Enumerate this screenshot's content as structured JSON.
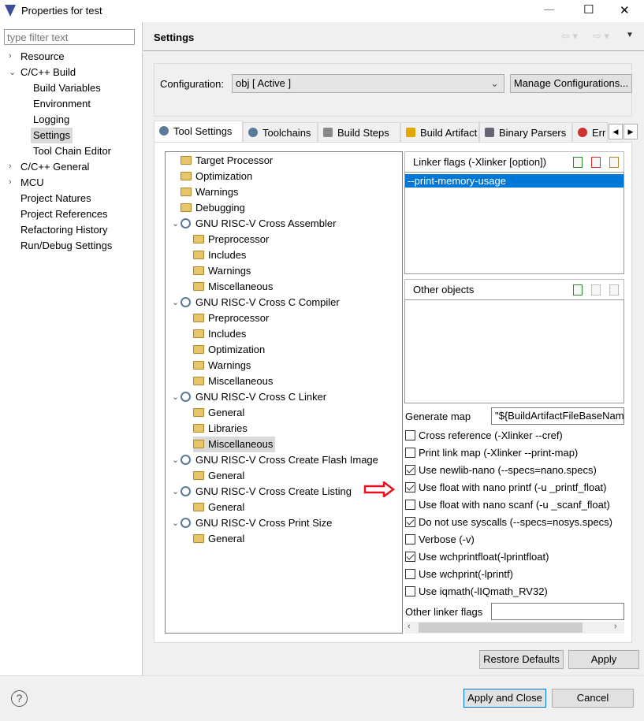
{
  "window": {
    "title": "Properties for test",
    "minimize": "—",
    "maximize": "☐",
    "close": "✕"
  },
  "filter": {
    "placeholder": "type filter text"
  },
  "nav": [
    {
      "label": "Resource",
      "level": 0,
      "chevron": "›"
    },
    {
      "label": "C/C++ Build",
      "level": 0,
      "chevron": "⌄"
    },
    {
      "label": "Build Variables",
      "level": 1
    },
    {
      "label": "Environment",
      "level": 1
    },
    {
      "label": "Logging",
      "level": 1
    },
    {
      "label": "Settings",
      "level": 1,
      "selected": true
    },
    {
      "label": "Tool Chain Editor",
      "level": 1
    },
    {
      "label": "C/C++ General",
      "level": 0,
      "chevron": "›"
    },
    {
      "label": "MCU",
      "level": 0,
      "chevron": "›"
    },
    {
      "label": "Project Natures",
      "level": 0
    },
    {
      "label": "Project References",
      "level": 0
    },
    {
      "label": "Refactoring History",
      "level": 0
    },
    {
      "label": "Run/Debug Settings",
      "level": 0
    }
  ],
  "header": {
    "title": "Settings"
  },
  "config": {
    "label": "Configuration:",
    "value": "obj  [ Active ]",
    "manage": "Manage Configurations..."
  },
  "tabs": [
    {
      "label": "Tool Settings",
      "active": true
    },
    {
      "label": "Toolchains"
    },
    {
      "label": "Build Steps"
    },
    {
      "label": "Build Artifact"
    },
    {
      "label": "Binary Parsers"
    },
    {
      "label": "Err"
    }
  ],
  "tooltree": [
    {
      "label": "Target Processor",
      "level": 0,
      "type": "folder"
    },
    {
      "label": "Optimization",
      "level": 0,
      "type": "folder"
    },
    {
      "label": "Warnings",
      "level": 0,
      "type": "folder"
    },
    {
      "label": "Debugging",
      "level": 0,
      "type": "folder"
    },
    {
      "label": "GNU RISC-V Cross Assembler",
      "level": 0,
      "type": "tool"
    },
    {
      "label": "Preprocessor",
      "level": 1,
      "type": "folder"
    },
    {
      "label": "Includes",
      "level": 1,
      "type": "folder"
    },
    {
      "label": "Warnings",
      "level": 1,
      "type": "folder"
    },
    {
      "label": "Miscellaneous",
      "level": 1,
      "type": "folder"
    },
    {
      "label": "GNU RISC-V Cross C Compiler",
      "level": 0,
      "type": "tool"
    },
    {
      "label": "Preprocessor",
      "level": 1,
      "type": "folder"
    },
    {
      "label": "Includes",
      "level": 1,
      "type": "folder"
    },
    {
      "label": "Optimization",
      "level": 1,
      "type": "folder"
    },
    {
      "label": "Warnings",
      "level": 1,
      "type": "folder"
    },
    {
      "label": "Miscellaneous",
      "level": 1,
      "type": "folder"
    },
    {
      "label": "GNU RISC-V Cross C Linker",
      "level": 0,
      "type": "tool"
    },
    {
      "label": "General",
      "level": 1,
      "type": "folder"
    },
    {
      "label": "Libraries",
      "level": 1,
      "type": "folder"
    },
    {
      "label": "Miscellaneous",
      "level": 1,
      "type": "folder",
      "selected": true
    },
    {
      "label": "GNU RISC-V Cross Create Flash Image",
      "level": 0,
      "type": "tool"
    },
    {
      "label": "General",
      "level": 1,
      "type": "folder"
    },
    {
      "label": "GNU RISC-V Cross Create Listing",
      "level": 0,
      "type": "tool"
    },
    {
      "label": "General",
      "level": 1,
      "type": "folder"
    },
    {
      "label": "GNU RISC-V Cross Print Size",
      "level": 0,
      "type": "tool"
    },
    {
      "label": "General",
      "level": 1,
      "type": "folder"
    }
  ],
  "linker_flags": {
    "title": "Linker flags (-Xlinker [option])",
    "items": [
      "--print-memory-usage"
    ]
  },
  "other_objects": {
    "title": "Other objects",
    "items": []
  },
  "generate_map": {
    "label": "Generate map",
    "value": "\"${BuildArtifactFileBaseName"
  },
  "checkboxes": [
    {
      "label": "Cross reference (-Xlinker --cref)",
      "checked": false
    },
    {
      "label": "Print link map (-Xlinker --print-map)",
      "checked": false
    },
    {
      "label": "Use newlib-nano (--specs=nano.specs)",
      "checked": true
    },
    {
      "label": "Use float with nano printf (-u _printf_float)",
      "checked": true
    },
    {
      "label": "Use float with nano scanf (-u _scanf_float)",
      "checked": false
    },
    {
      "label": "Do not use syscalls (--specs=nosys.specs)",
      "checked": true
    },
    {
      "label": "Verbose (-v)",
      "checked": false
    },
    {
      "label": "Use wchprintfloat(-lprintfloat)",
      "checked": true
    },
    {
      "label": "Use wchprint(-lprintf)",
      "checked": false
    },
    {
      "label": "Use iqmath(-lIQmath_RV32)",
      "checked": false
    }
  ],
  "other_linker_flags": {
    "label": "Other linker flags",
    "value": ""
  },
  "buttons": {
    "restore": "Restore Defaults",
    "apply": "Apply",
    "apply_close": "Apply and Close",
    "cancel": "Cancel",
    "help": "?"
  },
  "colors": {
    "selection": "#0078d7",
    "arrow": "#e81123"
  }
}
